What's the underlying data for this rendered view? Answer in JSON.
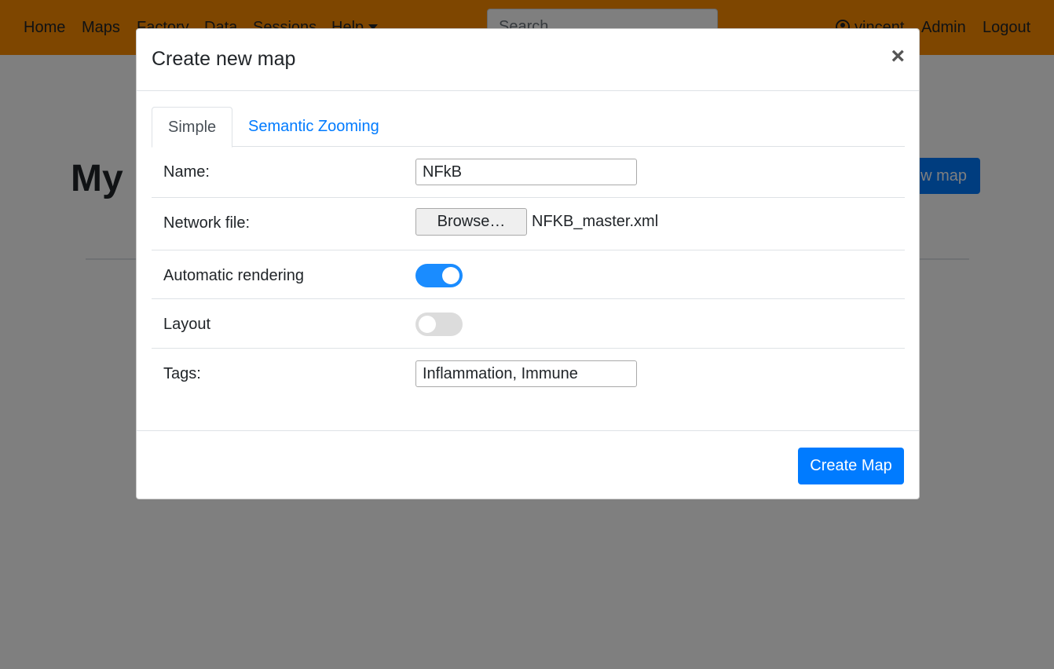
{
  "navbar": {
    "links": [
      "Home",
      "Maps",
      "Factory",
      "Data",
      "Sessions",
      "Help"
    ],
    "search_placeholder": "Search",
    "user": "vincent",
    "admin": "Admin",
    "logout": "Logout",
    "brand_color": "#fd8c00"
  },
  "page": {
    "title": "My",
    "new_map_button": "w map"
  },
  "modal": {
    "title": "Create new map",
    "close": "×",
    "tabs": [
      "Simple",
      "Semantic Zooming"
    ],
    "active_tab": "Simple",
    "fields": {
      "name_label": "Name:",
      "name_value": "NFkB",
      "network_label": "Network file:",
      "browse_label": "Browse…",
      "file_name": "NFKB_master.xml",
      "auto_render_label": "Automatic rendering",
      "auto_render_on": true,
      "layout_label": "Layout",
      "layout_on": false,
      "tags_label": "Tags:",
      "tags_value": "Inflammation, Immune"
    },
    "submit": "Create Map"
  }
}
